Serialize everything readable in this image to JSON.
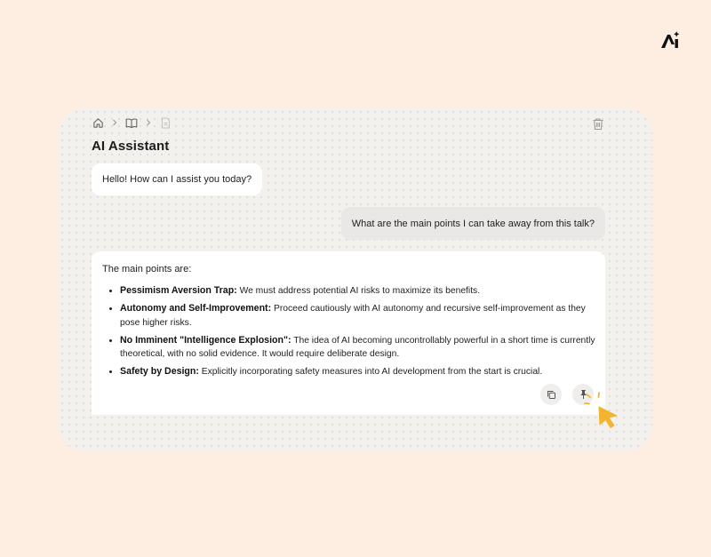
{
  "panel": {
    "title": "AI Assistant",
    "breadcrumb": [
      "home-icon",
      "book-icon",
      "document-icon"
    ]
  },
  "messages": {
    "greeting": "Hello! How can I assist you today?",
    "user_question": "What are the main points I can take away from this talk?",
    "answer_intro": "The main points are:",
    "points": [
      {
        "title": "Pessimism Aversion Trap:",
        "text": " We must address potential AI risks to maximize its benefits."
      },
      {
        "title": "Autonomy and Self-Improvement:",
        "text": " Proceed cautiously with AI autonomy and recursive self-improvement as they pose higher risks."
      },
      {
        "title": "No Imminent \"Intelligence Explosion\":",
        "text": " The idea of AI becoming uncontrollably powerful in a short time is currently theoretical, with no solid evidence. It would require deliberate design."
      },
      {
        "title": "Safety by Design:",
        "text": " Explicitly incorporating safety measures into AI development from the start is crucial."
      }
    ]
  },
  "actions": [
    "copy-icon",
    "pin-icon",
    "trash-icon"
  ],
  "colors": {
    "page_bg": "#fdeee1",
    "cursor": "#f2b431",
    "panel_bg": "#f3f1ee"
  }
}
